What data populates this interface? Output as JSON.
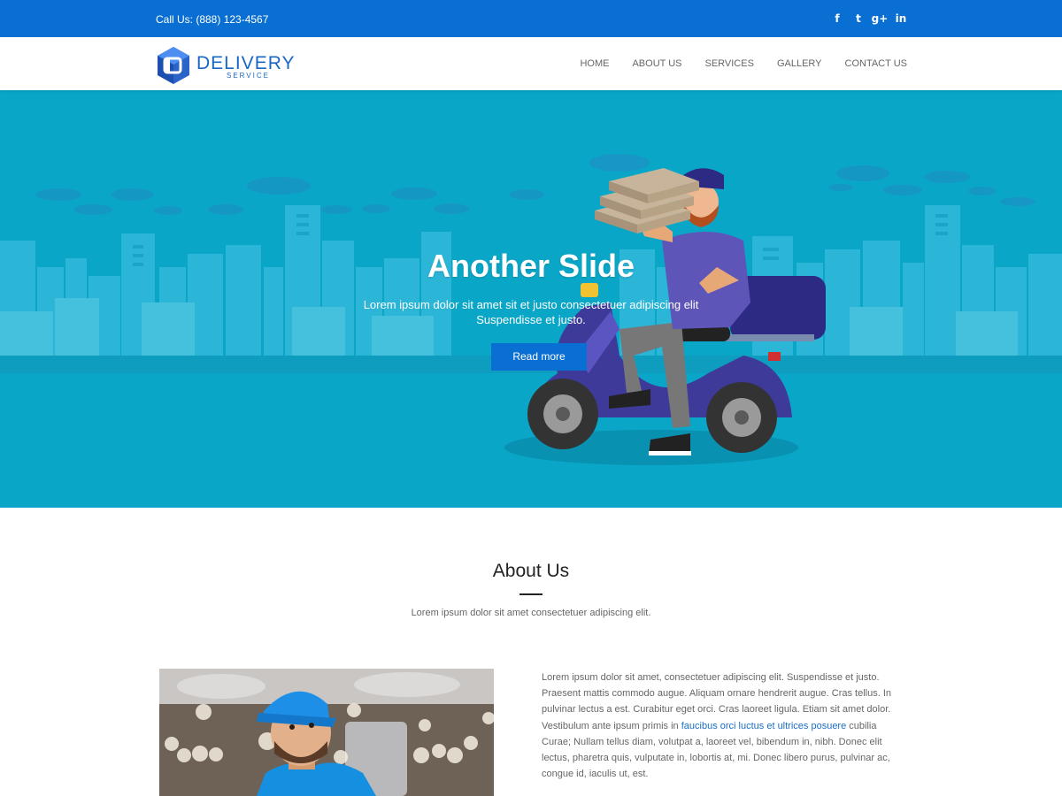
{
  "topbar": {
    "phone": "Call Us: (888) 123-4567",
    "social": [
      {
        "icon": "facebook-icon",
        "glyph": "f"
      },
      {
        "icon": "twitter-icon",
        "glyph": "t"
      },
      {
        "icon": "google-plus-icon",
        "glyph": "g+"
      },
      {
        "icon": "linkedin-icon",
        "glyph": "in"
      }
    ]
  },
  "logo": {
    "brand": "DELIVERY",
    "sub": "SERVICE"
  },
  "nav": {
    "items": [
      "HOME",
      "ABOUT US",
      "SERVICES",
      "GALLERY",
      "CONTACT US"
    ]
  },
  "hero": {
    "title": "Another Slide",
    "description": "Lorem ipsum dolor sit amet sit et justo consectetuer adipiscing elit Suspendisse et justo.",
    "button": "Read more"
  },
  "about": {
    "title": "About Us",
    "subtitle": "Lorem ipsum dolor sit amet consectetuer adipiscing elit.",
    "text_before_link": "Lorem ipsum dolor sit amet, consectetuer adipiscing elit. Suspendisse et justo. Praesent mattis commodo augue. Aliquam ornare hendrerit augue. Cras tellus. In pulvinar lectus a est. Curabitur eget orci. Cras laoreet ligula. Etiam sit amet dolor. Vestibulum ante ipsum primis in ",
    "link_text": "faucibus orci luctus et ultrices posuere",
    "text_after_link": " cubilia Curae; Nullam tellus diam, volutpat a, laoreet vel, bibendum in, nibh. Donec elit lectus, pharetra quis, vulputate in, lobortis at, mi. Donec libero purus, pulvinar ac, congue id, iaculis ut, est."
  },
  "colors": {
    "topbar": "#0a6fd3",
    "hero_bg": "#0aa6c7",
    "accent": "#0a6fd3",
    "link": "#1a6ec8"
  }
}
